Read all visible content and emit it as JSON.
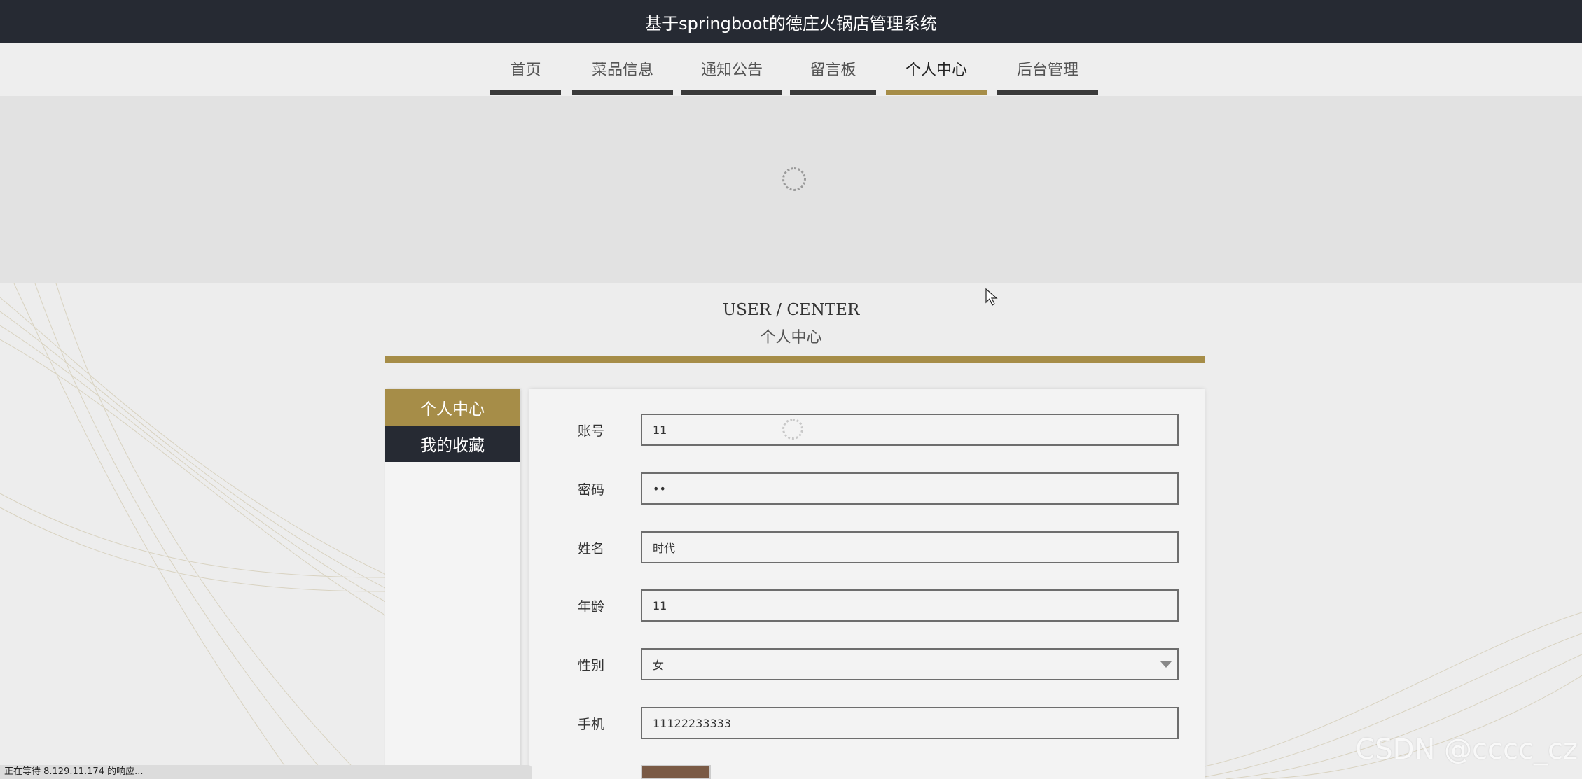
{
  "header": {
    "title": "基于springboot的德庄火锅店管理系统"
  },
  "nav": {
    "items": [
      {
        "label": "首页"
      },
      {
        "label": "菜品信息"
      },
      {
        "label": "通知公告"
      },
      {
        "label": "留言板"
      },
      {
        "label": "个人中心",
        "active": true
      },
      {
        "label": "后台管理"
      }
    ]
  },
  "section": {
    "title_en": "USER / CENTER",
    "title_cn": "个人中心"
  },
  "sidebar": {
    "items": [
      {
        "label": "个人中心",
        "active": true
      },
      {
        "label": "我的收藏"
      }
    ]
  },
  "form": {
    "account": {
      "label": "账号",
      "value": "11"
    },
    "password": {
      "label": "密码",
      "value": "••"
    },
    "name": {
      "label": "姓名",
      "value": "时代"
    },
    "age": {
      "label": "年龄",
      "value": "11"
    },
    "gender": {
      "label": "性别",
      "value": "女"
    },
    "phone": {
      "label": "手机",
      "value": "11122233333"
    }
  },
  "status": {
    "text": "正在等待 8.129.11.174 的响应..."
  },
  "watermark": "CSDN @cccc_cz",
  "colors": {
    "accent": "#a68d48",
    "dark": "#262a33"
  }
}
